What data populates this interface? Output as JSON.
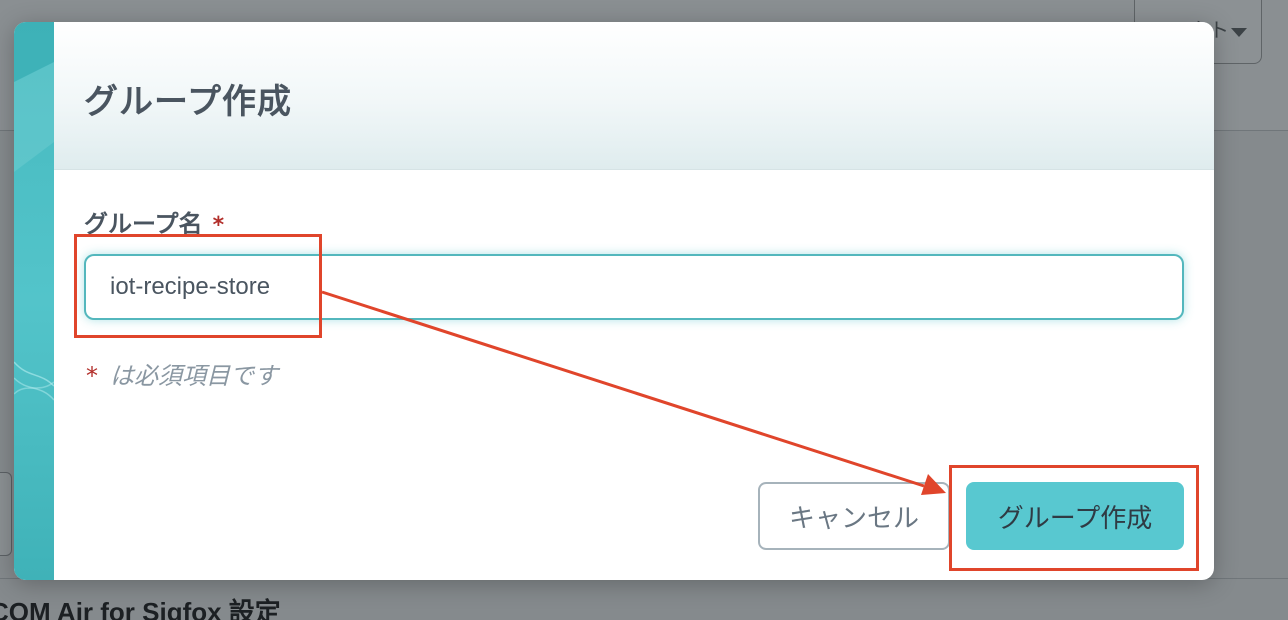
{
  "background": {
    "dropdown_text": "エクト",
    "section_heading": "COM Air for Sigfox 設定"
  },
  "dialog": {
    "title": "グループ作成",
    "field": {
      "label": "グループ名",
      "required_mark": "*",
      "value": "iot-recipe-store",
      "placeholder": ""
    },
    "required_note": {
      "mark": "*",
      "text": "は必須項目です"
    },
    "buttons": {
      "cancel": "キャンセル",
      "create": "グループ作成"
    }
  },
  "colors": {
    "accent": "#58c8d0",
    "annotation": "#e0452b",
    "required": "#b22e2a"
  },
  "icons": {
    "dropdown": "caret-down-icon",
    "annotation": "arrow-icon"
  }
}
